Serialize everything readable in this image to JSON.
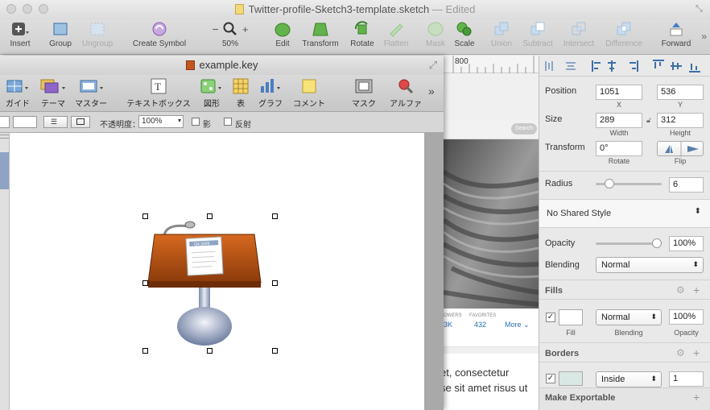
{
  "window": {
    "title": "Twitter-profile-Sketch3-template.sketch",
    "status": "— Edited"
  },
  "toolbar": {
    "insert": "Insert",
    "group": "Group",
    "ungroup": "Ungroup",
    "create_symbol": "Create Symbol",
    "zoom": "50%",
    "zoom_minus": "−",
    "zoom_plus": "+",
    "edit": "Edit",
    "transform": "Transform",
    "rotate": "Rotate",
    "flatten": "Flatten",
    "mask": "Mask",
    "scale": "Scale",
    "union": "Union",
    "subtract": "Subtract",
    "intersect": "Intersect",
    "difference": "Difference",
    "forward": "Forward"
  },
  "ruler": {
    "mark": "800"
  },
  "canvas": {
    "search_label": "Search",
    "stat_label": "OWERS",
    "stat_value": "3K",
    "favorites_label": "FAVORITES",
    "favorites_value": "432",
    "more_label": "More",
    "lorem_line1": "et, consectetur",
    "lorem_line2": "se sit amet risus ut"
  },
  "keynote": {
    "title": "example.key",
    "toolbar": [
      "ガイド",
      "テーマ",
      "マスター",
      "テキストボックス",
      "図形",
      "表",
      "グラフ",
      "コメント",
      "マスク",
      "アルファ"
    ],
    "opacity_label": "不透明度：",
    "opacity_value": "100%",
    "shadow_label": "影",
    "reflection_label": "反射",
    "podium_label": "Q4 2009"
  },
  "inspector": {
    "position": {
      "label": "Position",
      "x": "1051",
      "y": "536",
      "x_label": "X",
      "y_label": "Y"
    },
    "size": {
      "label": "Size",
      "w": "289",
      "h": "312",
      "w_label": "Width",
      "h_label": "Height"
    },
    "transform": {
      "label": "Transform",
      "rotate": "0°",
      "rotate_label": "Rotate",
      "flip_label": "Flip"
    },
    "radius": {
      "label": "Radius",
      "value": "6",
      "level": 0.15
    },
    "shared_style": "No Shared Style",
    "opacity": {
      "label": "Opacity",
      "value": "100%",
      "level": 1.0
    },
    "blending": {
      "label": "Blending",
      "value": "Normal"
    },
    "fills": {
      "header": "Fills",
      "blend": "Normal",
      "opacity": "100%",
      "fill_label": "Fill",
      "blending_label": "Blending",
      "opacity_label": "Opacity"
    },
    "borders": {
      "header": "Borders",
      "position": "Inside",
      "width": "1"
    },
    "export": "Make Exportable"
  },
  "colors": {
    "accent": "#2d7bd6",
    "link": "#2a6fb0",
    "fill": "#ffffff",
    "border_swatch": "#d9e8e4"
  }
}
